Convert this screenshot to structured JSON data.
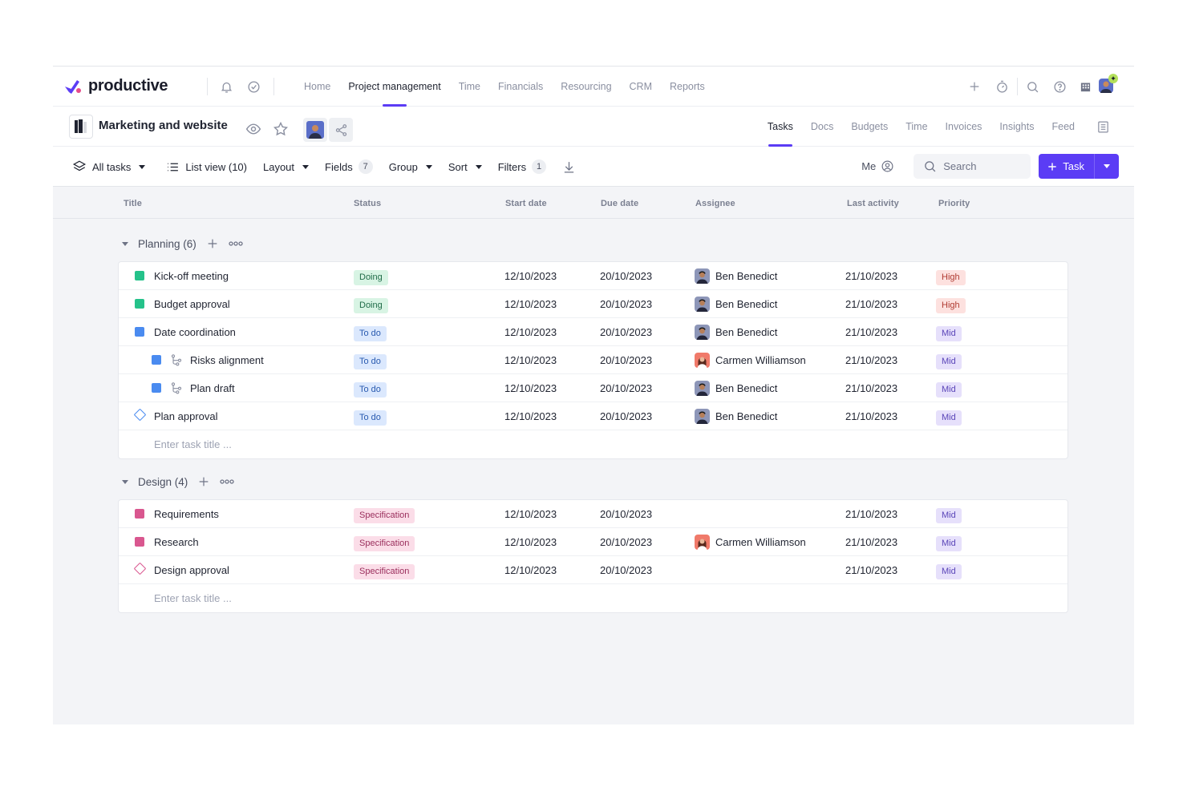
{
  "colors": {
    "accent": "#5b3cf5",
    "planning_square": "#25c28a",
    "todo_square": "#4a8bf0",
    "design_square": "#d9578f",
    "status_doing_bg": "#d8f4e4",
    "status_doing_fg": "#1f6b48",
    "status_todo_bg": "#dbe8fd",
    "status_todo_fg": "#2a5bb0",
    "status_spec_bg": "#fbdde8",
    "status_spec_fg": "#9a2e5c",
    "priority_high_bg": "#fde1df",
    "priority_high_fg": "#b03b32",
    "priority_mid_bg": "#e6e0fb",
    "priority_mid_fg": "#5a45b8"
  },
  "app": {
    "brand": "productive",
    "nav": [
      "Home",
      "Project management",
      "Time",
      "Financials",
      "Resourcing",
      "CRM",
      "Reports"
    ],
    "active_nav": "Project management",
    "top_icons": [
      "bell-icon",
      "check-circle-icon",
      "plus-icon",
      "timer-icon",
      "search-icon",
      "help-icon",
      "building-icon"
    ]
  },
  "project": {
    "title": "Marketing and website",
    "tabs": [
      "Tasks",
      "Docs",
      "Budgets",
      "Time",
      "Invoices",
      "Insights",
      "Feed"
    ],
    "active_tab": "Tasks"
  },
  "toolbar": {
    "all_tasks": "All tasks",
    "list_view": "List view (10)",
    "layout": "Layout",
    "fields": "Fields",
    "fields_count": "7",
    "group": "Group",
    "sort": "Sort",
    "filters": "Filters",
    "filters_count": "1",
    "me": "Me",
    "search_placeholder": "Search",
    "task_button": "Task"
  },
  "columns": {
    "title": "Title",
    "status": "Status",
    "start": "Start date",
    "due": "Due date",
    "assignee": "Assignee",
    "activity": "Last activity",
    "priority": "Priority"
  },
  "groups": [
    {
      "label": "Planning (6)",
      "add_placeholder": "Enter task title ...",
      "tasks": [
        {
          "title": "Kick-off meeting",
          "marker": "square",
          "color": "#25c28a",
          "sub": false,
          "status": "Doing",
          "status_kind": "doing",
          "start": "12/10/2023",
          "due": "20/10/2023",
          "assignee": "Ben Benedict",
          "avatar": "ben",
          "activity": "21/10/2023",
          "priority": "High",
          "priority_kind": "high"
        },
        {
          "title": "Budget approval",
          "marker": "square",
          "color": "#25c28a",
          "sub": false,
          "status": "Doing",
          "status_kind": "doing",
          "start": "12/10/2023",
          "due": "20/10/2023",
          "assignee": "Ben Benedict",
          "avatar": "ben",
          "activity": "21/10/2023",
          "priority": "High",
          "priority_kind": "high"
        },
        {
          "title": "Date coordination",
          "marker": "square",
          "color": "#4a8bf0",
          "sub": false,
          "status": "To do",
          "status_kind": "todo",
          "start": "12/10/2023",
          "due": "20/10/2023",
          "assignee": "Ben Benedict",
          "avatar": "ben",
          "activity": "21/10/2023",
          "priority": "Mid",
          "priority_kind": "mid"
        },
        {
          "title": "Risks alignment",
          "marker": "square",
          "color": "#4a8bf0",
          "sub": true,
          "status": "To do",
          "status_kind": "todo",
          "start": "12/10/2023",
          "due": "20/10/2023",
          "assignee": "Carmen Williamson",
          "avatar": "carmen",
          "activity": "21/10/2023",
          "priority": "Mid",
          "priority_kind": "mid"
        },
        {
          "title": "Plan draft",
          "marker": "square",
          "color": "#4a8bf0",
          "sub": true,
          "status": "To do",
          "status_kind": "todo",
          "start": "12/10/2023",
          "due": "20/10/2023",
          "assignee": "Ben Benedict",
          "avatar": "ben",
          "activity": "21/10/2023",
          "priority": "Mid",
          "priority_kind": "mid"
        },
        {
          "title": "Plan approval",
          "marker": "diamond",
          "color": "#4a8bf0",
          "sub": false,
          "status": "To do",
          "status_kind": "todo",
          "start": "12/10/2023",
          "due": "20/10/2023",
          "assignee": "Ben Benedict",
          "avatar": "ben",
          "activity": "21/10/2023",
          "priority": "Mid",
          "priority_kind": "mid"
        }
      ]
    },
    {
      "label": "Design (4)",
      "add_placeholder": "Enter task title ...",
      "tasks": [
        {
          "title": "Requirements",
          "marker": "square",
          "color": "#d9578f",
          "sub": false,
          "status": "Specification",
          "status_kind": "spec",
          "start": "12/10/2023",
          "due": "20/10/2023",
          "assignee": "",
          "avatar": "",
          "activity": "21/10/2023",
          "priority": "Mid",
          "priority_kind": "mid"
        },
        {
          "title": "Research",
          "marker": "square",
          "color": "#d9578f",
          "sub": false,
          "status": "Specification",
          "status_kind": "spec",
          "start": "12/10/2023",
          "due": "20/10/2023",
          "assignee": "Carmen Williamson",
          "avatar": "carmen",
          "activity": "21/10/2023",
          "priority": "Mid",
          "priority_kind": "mid"
        },
        {
          "title": "Design approval",
          "marker": "diamond",
          "color": "#d9578f",
          "sub": false,
          "status": "Specification",
          "status_kind": "spec",
          "start": "12/10/2023",
          "due": "20/10/2023",
          "assignee": "",
          "avatar": "",
          "activity": "21/10/2023",
          "priority": "Mid",
          "priority_kind": "mid"
        }
      ]
    }
  ]
}
